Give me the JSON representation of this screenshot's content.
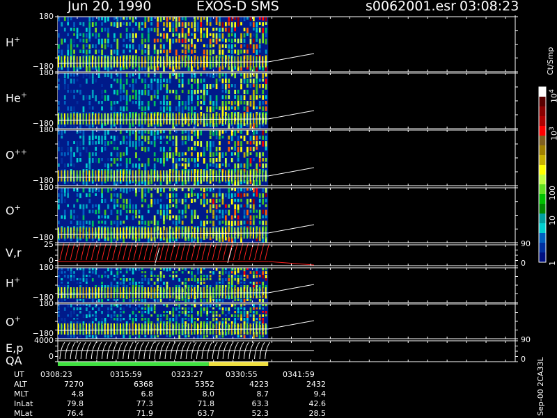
{
  "header": {
    "date": "Jun 20, 1990",
    "mission": "EXOS-D SMS",
    "file": "s0062001.esr",
    "time": "03:08:23"
  },
  "colorbar": {
    "units": "Ct/Smp",
    "labels": [
      "10",
      "10",
      "10",
      "100",
      "10",
      "1"
    ],
    "sup": [
      "4",
      "3"
    ],
    "colors": [
      "#ffffff",
      "#5a0000",
      "#8b0000",
      "#b00000",
      "#ff0000",
      "#806020",
      "#a08000",
      "#c8b000",
      "#ffff00",
      "#c0ff40",
      "#60e020",
      "#00c000",
      "#008800",
      "#00a0a0",
      "#00d0d0",
      "#0060c0",
      "#0030a0",
      "#001080"
    ]
  },
  "panels": [
    {
      "label": "H",
      "sup": "+",
      "top_tick": "180",
      "bottom_tick": "−180"
    },
    {
      "label": "He",
      "sup": "+",
      "top_tick": "180",
      "bottom_tick": "−180"
    },
    {
      "label": "O",
      "sup": "++",
      "top_tick": "180",
      "bottom_tick": "−180"
    },
    {
      "label": "O",
      "sup": "+",
      "top_tick": "180",
      "bottom_tick": "−180"
    },
    {
      "label": "V,r",
      "top_tick": "25",
      "bottom_tick": "0",
      "right_top": "90",
      "right_bottom": "0"
    },
    {
      "label": "H",
      "sup": "+",
      "top_tick": "180",
      "bottom_tick": "−180"
    },
    {
      "label": "O",
      "sup": "+",
      "top_tick": "180",
      "bottom_tick": "−180"
    },
    {
      "label": "E,p",
      "label2": "QA",
      "top_tick": "4000",
      "bottom_tick": "0",
      "right_top": "90",
      "right_bottom": "0"
    }
  ],
  "side_note": "Sep-00 2CA33L",
  "table": {
    "rows": [
      {
        "name": "UT",
        "values": [
          "0308:23",
          "0315:59",
          "0323:27",
          "0330:55",
          "0341:59"
        ]
      },
      {
        "name": "ALT",
        "values": [
          "7270",
          "6368",
          "5352",
          "4223",
          "2432"
        ]
      },
      {
        "name": "MLT",
        "values": [
          "4.8",
          "6.8",
          "8.0",
          "8.7",
          "9.4"
        ]
      },
      {
        "name": "InLat",
        "values": [
          "79.8",
          "77.3",
          "71.8",
          "63.3",
          "42.6"
        ]
      },
      {
        "name": "MLat",
        "values": [
          "76.4",
          "71.9",
          "63.7",
          "52.3",
          "28.5"
        ]
      }
    ]
  },
  "chart_data": {
    "type": "heatmap",
    "title": "",
    "x_ticks": [
      "0308:23",
      "0315:59",
      "0323:27",
      "0330:55",
      "0341:59"
    ],
    "data_end_fraction": 0.46,
    "qa_segments": [
      {
        "color": "#40e040",
        "from": 0.0,
        "to": 0.33
      },
      {
        "color": "#f0e040",
        "from": 0.33,
        "to": 0.46
      }
    ],
    "legend": "right"
  }
}
